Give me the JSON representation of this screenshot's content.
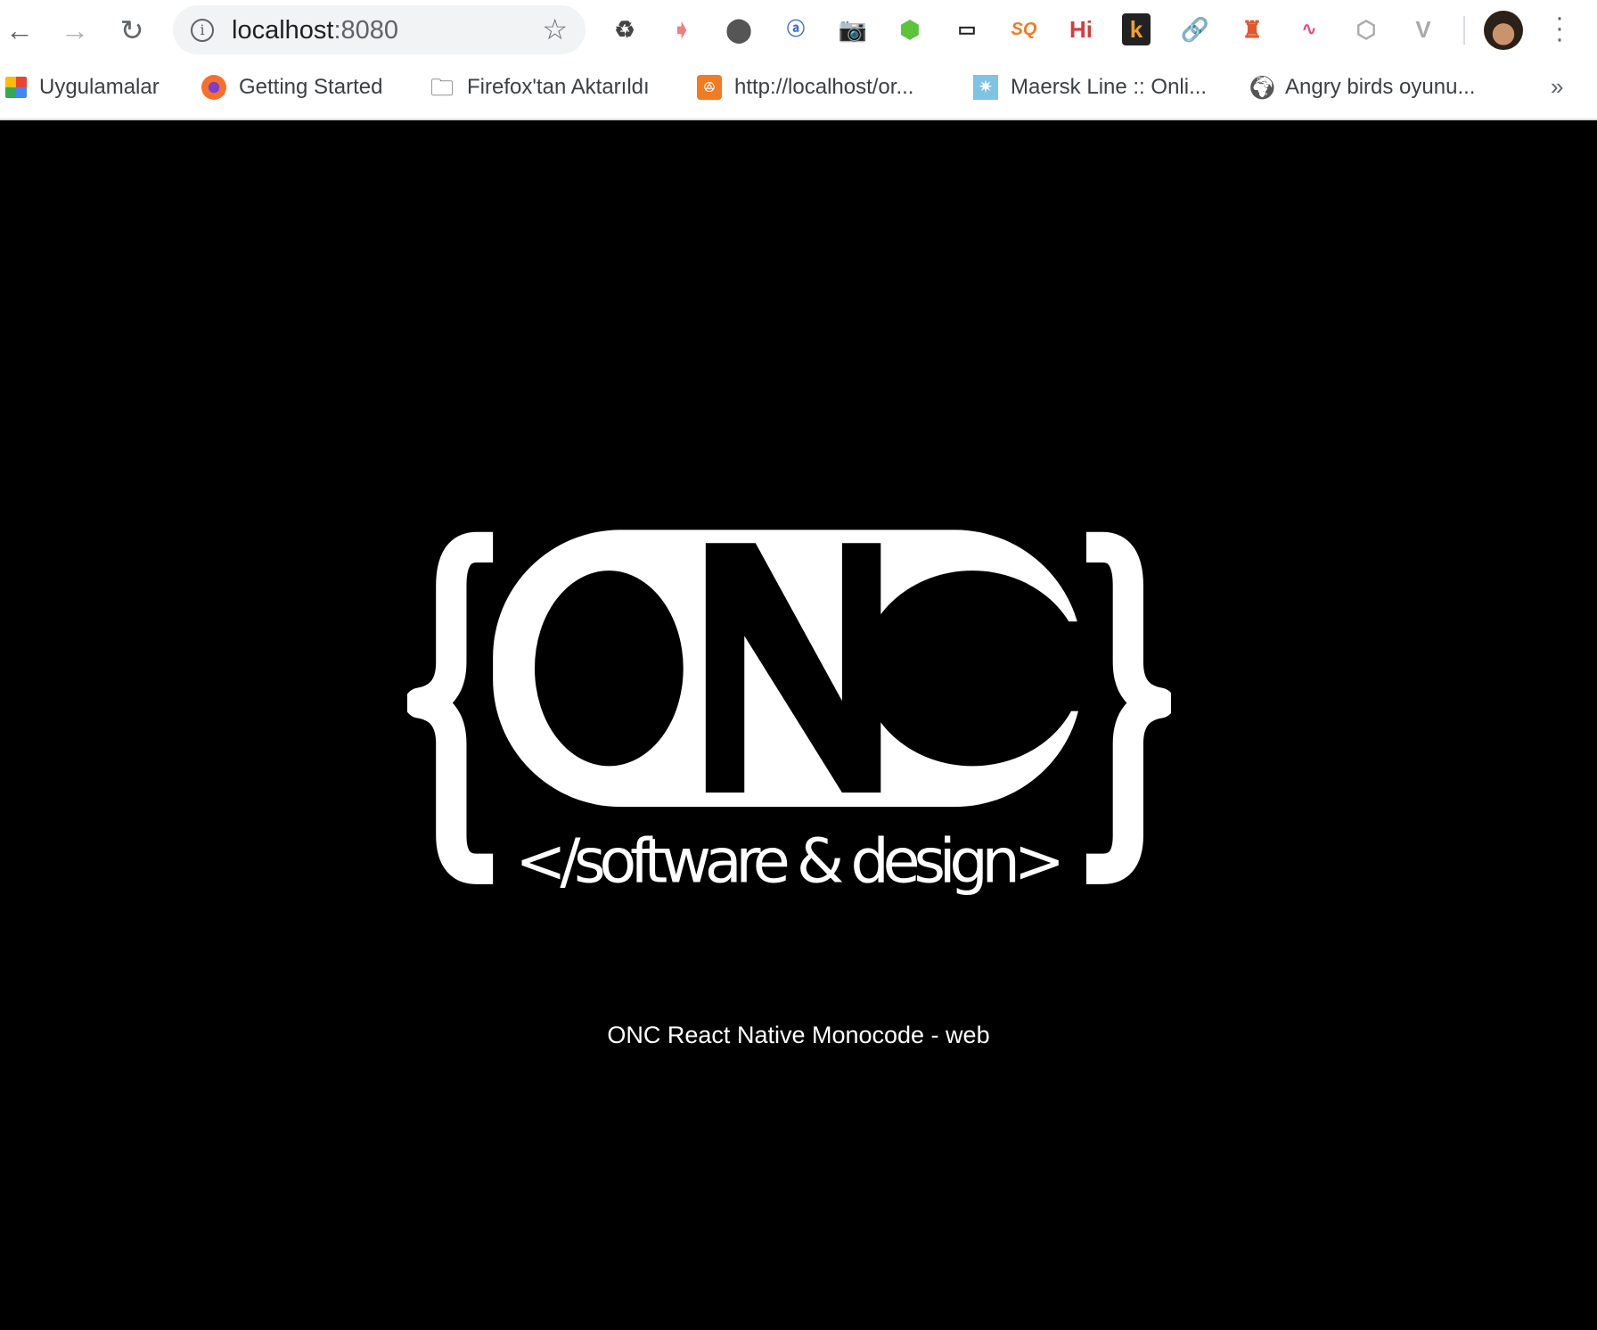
{
  "browser": {
    "url_host": "localhost",
    "url_port": ":8080",
    "extensions": [
      "recycle-icon",
      "arrow-icon",
      "shield-icon",
      "amazon-icon",
      "camera-icon",
      "thumbs-up-icon",
      "devices-icon",
      "sq-icon",
      "hi-icon",
      "k-icon",
      "link-icon",
      "lighthouse-icon",
      "wave-icon",
      "cube-icon",
      "vue-icon"
    ],
    "bookmarks": [
      {
        "label": "Uygulamalar",
        "icon": "apps-grid-icon"
      },
      {
        "label": "Getting Started",
        "icon": "firefox-icon"
      },
      {
        "label": "Firefox'tan Aktarıldı",
        "icon": "folder-icon"
      },
      {
        "label": "http://localhost/or...",
        "icon": "xampp-icon"
      },
      {
        "label": "Maersk Line :: Onli...",
        "icon": "maersk-star-icon"
      },
      {
        "label": "Angry birds oyunu...",
        "icon": "globe-icon"
      }
    ],
    "more_label": "»"
  },
  "page": {
    "logo": {
      "letters": "ONC",
      "tagline": "</software & design>"
    },
    "caption": "ONC React Native Monocode - web"
  }
}
